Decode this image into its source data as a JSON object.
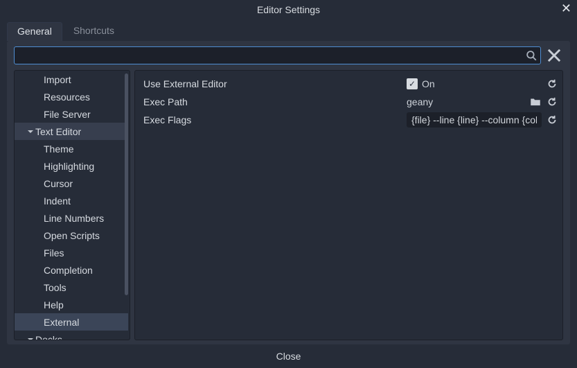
{
  "window": {
    "title": "Editor Settings"
  },
  "tabs": {
    "general": "General",
    "shortcuts": "Shortcuts"
  },
  "search": {
    "placeholder": ""
  },
  "sidebar": {
    "items": [
      {
        "label": "Import",
        "type": "item"
      },
      {
        "label": "Resources",
        "type": "item"
      },
      {
        "label": "File Server",
        "type": "item"
      },
      {
        "label": "Text Editor",
        "type": "section",
        "highlighted": true
      },
      {
        "label": "Theme",
        "type": "item"
      },
      {
        "label": "Highlighting",
        "type": "item"
      },
      {
        "label": "Cursor",
        "type": "item"
      },
      {
        "label": "Indent",
        "type": "item"
      },
      {
        "label": "Line Numbers",
        "type": "item"
      },
      {
        "label": "Open Scripts",
        "type": "item"
      },
      {
        "label": "Files",
        "type": "item"
      },
      {
        "label": "Completion",
        "type": "item"
      },
      {
        "label": "Tools",
        "type": "item"
      },
      {
        "label": "Help",
        "type": "item"
      },
      {
        "label": "External",
        "type": "item",
        "selected": true
      },
      {
        "label": "Docks",
        "type": "section"
      }
    ]
  },
  "properties": {
    "use_external_editor": {
      "label": "Use External Editor",
      "checked": true,
      "on_text": "On"
    },
    "exec_path": {
      "label": "Exec Path",
      "value": "geany"
    },
    "exec_flags": {
      "label": "Exec Flags",
      "value": "{file} --line {line} --column {col}"
    }
  },
  "footer": {
    "close": "Close"
  }
}
